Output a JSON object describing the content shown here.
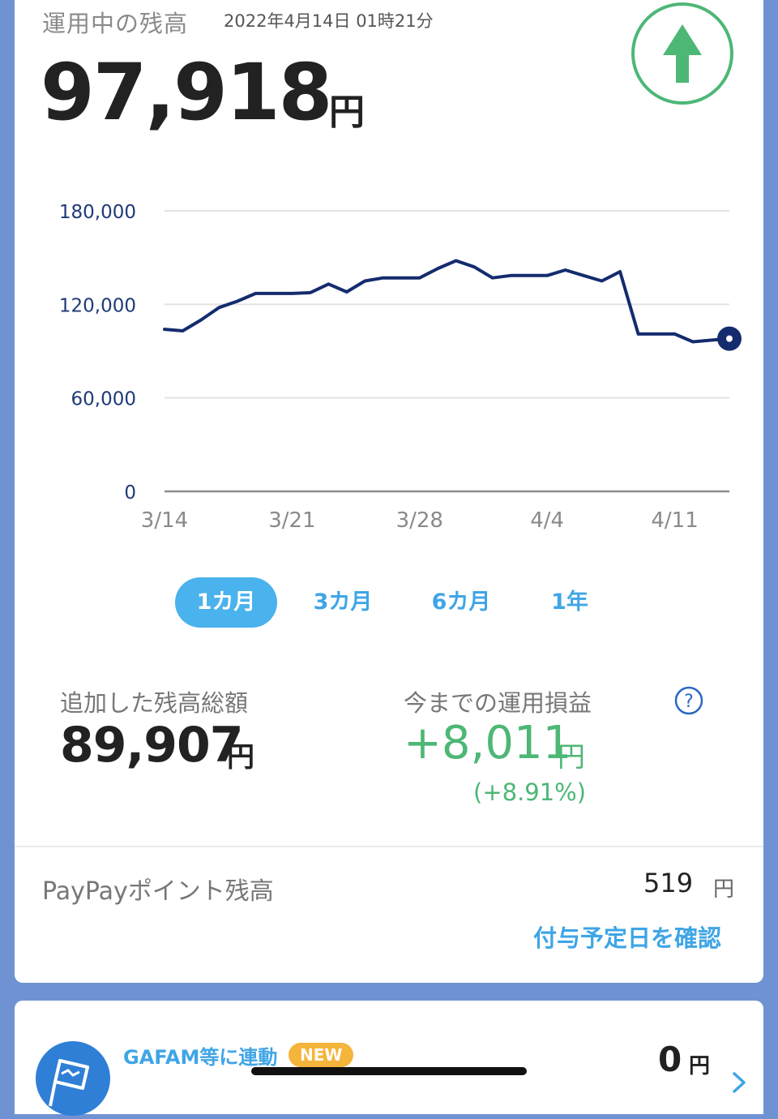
{
  "header": {
    "title": "運用中の残高",
    "timestamp": "2022年4月14日 01時21分",
    "balance": "97,918",
    "balance_unit": "円"
  },
  "chart_data": {
    "type": "line",
    "x": [
      "3/14",
      "3/15",
      "3/16",
      "3/17",
      "3/18",
      "3/19",
      "3/20",
      "3/21",
      "3/22",
      "3/23",
      "3/24",
      "3/25",
      "3/26",
      "3/27",
      "3/28",
      "3/29",
      "3/30",
      "3/31",
      "4/1",
      "4/2",
      "4/3",
      "4/4",
      "4/5",
      "4/6",
      "4/7",
      "4/8",
      "4/9",
      "4/10",
      "4/11",
      "4/12",
      "4/13",
      "4/14"
    ],
    "series": [
      {
        "values": [
          104000,
          103000,
          110000,
          118000,
          122000,
          127000,
          127000,
          127000,
          127500,
          133000,
          128000,
          135000,
          137000,
          137000,
          137000,
          143000,
          148000,
          144000,
          137000,
          138500,
          138500,
          138500,
          142000,
          138500,
          135000,
          141000,
          101000,
          101000,
          101000,
          96000,
          97000,
          98000
        ]
      }
    ],
    "x_ticks": [
      "3/14",
      "3/21",
      "3/28",
      "4/4",
      "4/11"
    ],
    "y_ticks": [
      "180,000",
      "120,000",
      "60,000",
      "0"
    ],
    "y_tick_values": [
      180000,
      120000,
      60000,
      0
    ],
    "ylim": [
      0,
      180000
    ],
    "grid": true,
    "line_color": "#142c6e"
  },
  "tabs": [
    {
      "label": "1カ月",
      "active": true
    },
    {
      "label": "3カ月",
      "active": false
    },
    {
      "label": "6カ月",
      "active": false
    },
    {
      "label": "1年",
      "active": false
    }
  ],
  "summary": {
    "added_label": "追加した残高総額",
    "added_value": "89,907",
    "added_unit": "円",
    "pl_label": "今までの運用損益",
    "pl_value": "+8,011",
    "pl_unit": "円",
    "pl_pct": "(+8.91%)",
    "help": "?"
  },
  "paypay": {
    "label": "PayPayポイント残高",
    "value": "519",
    "unit": "円",
    "link": "付与予定日を確認"
  },
  "gafam": {
    "label": "GAFAM等に連動",
    "badge": "NEW",
    "value": "0",
    "unit": "円"
  },
  "colors": {
    "accent": "#3fa5e6",
    "positive": "#4db776",
    "line": "#142c6e",
    "background": "#6f93d2"
  }
}
